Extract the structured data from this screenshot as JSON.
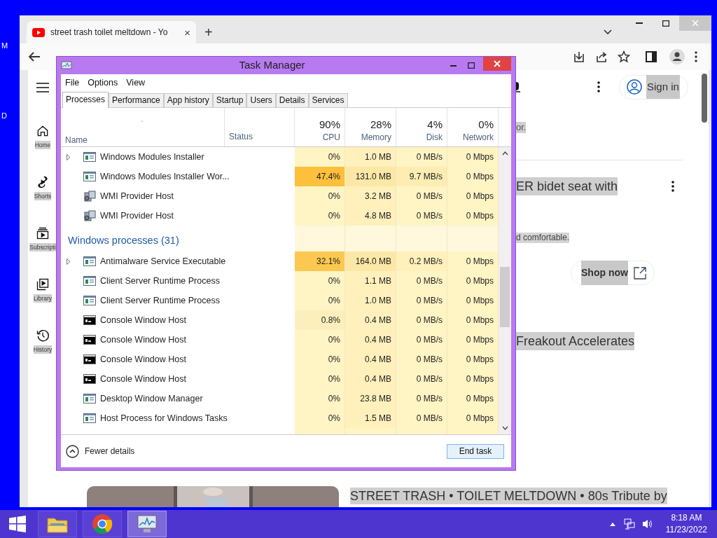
{
  "desktop": {
    "icon_labels": [
      "M",
      "D"
    ]
  },
  "browser": {
    "tab": {
      "title": "street trash toilet meltdown - Yo",
      "close": "×"
    },
    "new_tab": "+",
    "youtube": {
      "sidebar": [
        {
          "kind": "home",
          "label": "Home"
        },
        {
          "kind": "shorts",
          "label": "Shorts"
        },
        {
          "kind": "subscriptions",
          "label": "Subscripti"
        },
        {
          "kind": "library",
          "label": "Library"
        },
        {
          "kind": "history",
          "label": "History"
        }
      ],
      "sign_in": "Sign in",
      "description_end": "or.",
      "ad_title": "ER bidet seat with",
      "ad_text": "d comfortable.",
      "shop_now": "Shop now",
      "video_title_1": "Freakout Accelerates",
      "video_title_2": "STREET TRASH • TOILET MELTDOWN • 80s Tribute by"
    }
  },
  "task_manager": {
    "title": "Task Manager",
    "menu": [
      "File",
      "Options",
      "View"
    ],
    "tabs": [
      {
        "label": "Processes",
        "selected": true
      },
      {
        "label": "Performance",
        "selected": false
      },
      {
        "label": "App history",
        "selected": false
      },
      {
        "label": "Startup",
        "selected": false
      },
      {
        "label": "Users",
        "selected": false
      },
      {
        "label": "Details",
        "selected": false
      },
      {
        "label": "Services",
        "selected": false
      }
    ],
    "columns": [
      {
        "label": "Name"
      },
      {
        "label": "Status"
      },
      {
        "label": "CPU",
        "total": "90%"
      },
      {
        "label": "Memory",
        "total": "28%"
      },
      {
        "label": "Disk",
        "total": "4%"
      },
      {
        "label": "Network",
        "total": "0%"
      }
    ],
    "rows": [
      {
        "kind": "app",
        "expandable": true,
        "name": "Windows Modules Installer",
        "cells": [
          {
            "value": "0%",
            "color": "#fff4c4"
          },
          {
            "value": "1.0 MB",
            "color": "#fff0bc"
          },
          {
            "value": "0 MB/s",
            "color": "#fff4c4"
          },
          {
            "value": "0 Mbps",
            "color": "#fff4c4"
          }
        ]
      },
      {
        "kind": "app",
        "expandable": false,
        "name": "Windows Modules Installer Wor...",
        "cells": [
          {
            "value": "47.4%",
            "color": "#fcc03d"
          },
          {
            "value": "131.0 MB",
            "color": "#fce8a6"
          },
          {
            "value": "9.7 MB/s",
            "color": "#fdedb3"
          },
          {
            "value": "0 Mbps",
            "color": "#fff4c4"
          }
        ]
      },
      {
        "kind": "wmi",
        "expandable": false,
        "name": "WMI Provider Host",
        "cells": [
          {
            "value": "0%",
            "color": "#fff4c4"
          },
          {
            "value": "3.2 MB",
            "color": "#fff0bc"
          },
          {
            "value": "0 MB/s",
            "color": "#fff4c4"
          },
          {
            "value": "0 Mbps",
            "color": "#fff4c4"
          }
        ]
      },
      {
        "kind": "wmi",
        "expandable": false,
        "name": "WMI Provider Host",
        "cells": [
          {
            "value": "0%",
            "color": "#fff4c4"
          },
          {
            "value": "4.8 MB",
            "color": "#fff0bc"
          },
          {
            "value": "0 MB/s",
            "color": "#fff4c4"
          },
          {
            "value": "0 Mbps",
            "color": "#fff4c4"
          }
        ]
      },
      {
        "kind": "group",
        "name": "Windows processes (31)"
      },
      {
        "kind": "app",
        "expandable": true,
        "name": "Antimalware Service Executable",
        "cells": [
          {
            "value": "32.1%",
            "color": "#fcc850"
          },
          {
            "value": "164.0 MB",
            "color": "#fce8a6"
          },
          {
            "value": "0.2 MB/s",
            "color": "#fff0bc"
          },
          {
            "value": "0 Mbps",
            "color": "#fff4c4"
          }
        ]
      },
      {
        "kind": "app",
        "expandable": false,
        "name": "Client Server Runtime Process",
        "cells": [
          {
            "value": "0%",
            "color": "#fff4c4"
          },
          {
            "value": "1.1 MB",
            "color": "#fff0bc"
          },
          {
            "value": "0 MB/s",
            "color": "#fff4c4"
          },
          {
            "value": "0 Mbps",
            "color": "#fff4c4"
          }
        ]
      },
      {
        "kind": "app",
        "expandable": false,
        "name": "Client Server Runtime Process",
        "cells": [
          {
            "value": "0%",
            "color": "#fff4c4"
          },
          {
            "value": "1.0 MB",
            "color": "#fff0bc"
          },
          {
            "value": "0 MB/s",
            "color": "#fff4c4"
          },
          {
            "value": "0 Mbps",
            "color": "#fff4c4"
          }
        ]
      },
      {
        "kind": "console",
        "expandable": false,
        "name": "Console Window Host",
        "cells": [
          {
            "value": "0.8%",
            "color": "#fcefbc"
          },
          {
            "value": "0.4 MB",
            "color": "#fff0bc"
          },
          {
            "value": "0 MB/s",
            "color": "#fff4c4"
          },
          {
            "value": "0 Mbps",
            "color": "#fff4c4"
          }
        ]
      },
      {
        "kind": "console",
        "expandable": false,
        "name": "Console Window Host",
        "cells": [
          {
            "value": "0%",
            "color": "#fff4c4"
          },
          {
            "value": "0.4 MB",
            "color": "#fff0bc"
          },
          {
            "value": "0 MB/s",
            "color": "#fff4c4"
          },
          {
            "value": "0 Mbps",
            "color": "#fff4c4"
          }
        ]
      },
      {
        "kind": "console",
        "expandable": false,
        "name": "Console Window Host",
        "cells": [
          {
            "value": "0%",
            "color": "#fff4c4"
          },
          {
            "value": "0.4 MB",
            "color": "#fff0bc"
          },
          {
            "value": "0 MB/s",
            "color": "#fff4c4"
          },
          {
            "value": "0 Mbps",
            "color": "#fff4c4"
          }
        ]
      },
      {
        "kind": "console",
        "expandable": false,
        "name": "Console Window Host",
        "cells": [
          {
            "value": "0%",
            "color": "#fff4c4"
          },
          {
            "value": "0.4 MB",
            "color": "#fff0bc"
          },
          {
            "value": "0 MB/s",
            "color": "#fff4c4"
          },
          {
            "value": "0 Mbps",
            "color": "#fff4c4"
          }
        ]
      },
      {
        "kind": "app",
        "expandable": false,
        "name": "Desktop Window Manager",
        "cells": [
          {
            "value": "0%",
            "color": "#fff4c4"
          },
          {
            "value": "23.8 MB",
            "color": "#fff0bc"
          },
          {
            "value": "0 MB/s",
            "color": "#fff4c4"
          },
          {
            "value": "0 Mbps",
            "color": "#fff4c4"
          }
        ]
      },
      {
        "kind": "app",
        "expandable": false,
        "name": "Host Process for Windows Tasks",
        "cells": [
          {
            "value": "0%",
            "color": "#fff4c4"
          },
          {
            "value": "1.5 MB",
            "color": "#fff0bc"
          },
          {
            "value": "0 MB/s",
            "color": "#fff4c4"
          },
          {
            "value": "0 Mbps",
            "color": "#fff4c4"
          }
        ]
      }
    ],
    "fewer_details": "Fewer details",
    "end_task": "End task"
  },
  "taskbar": {
    "apps": [
      {
        "kind": "explorer",
        "selected": false
      },
      {
        "kind": "chrome",
        "selected": false
      },
      {
        "kind": "task-manager",
        "selected": true
      }
    ],
    "clock": {
      "time": "8:18 AM",
      "date": "11/23/2022"
    }
  }
}
